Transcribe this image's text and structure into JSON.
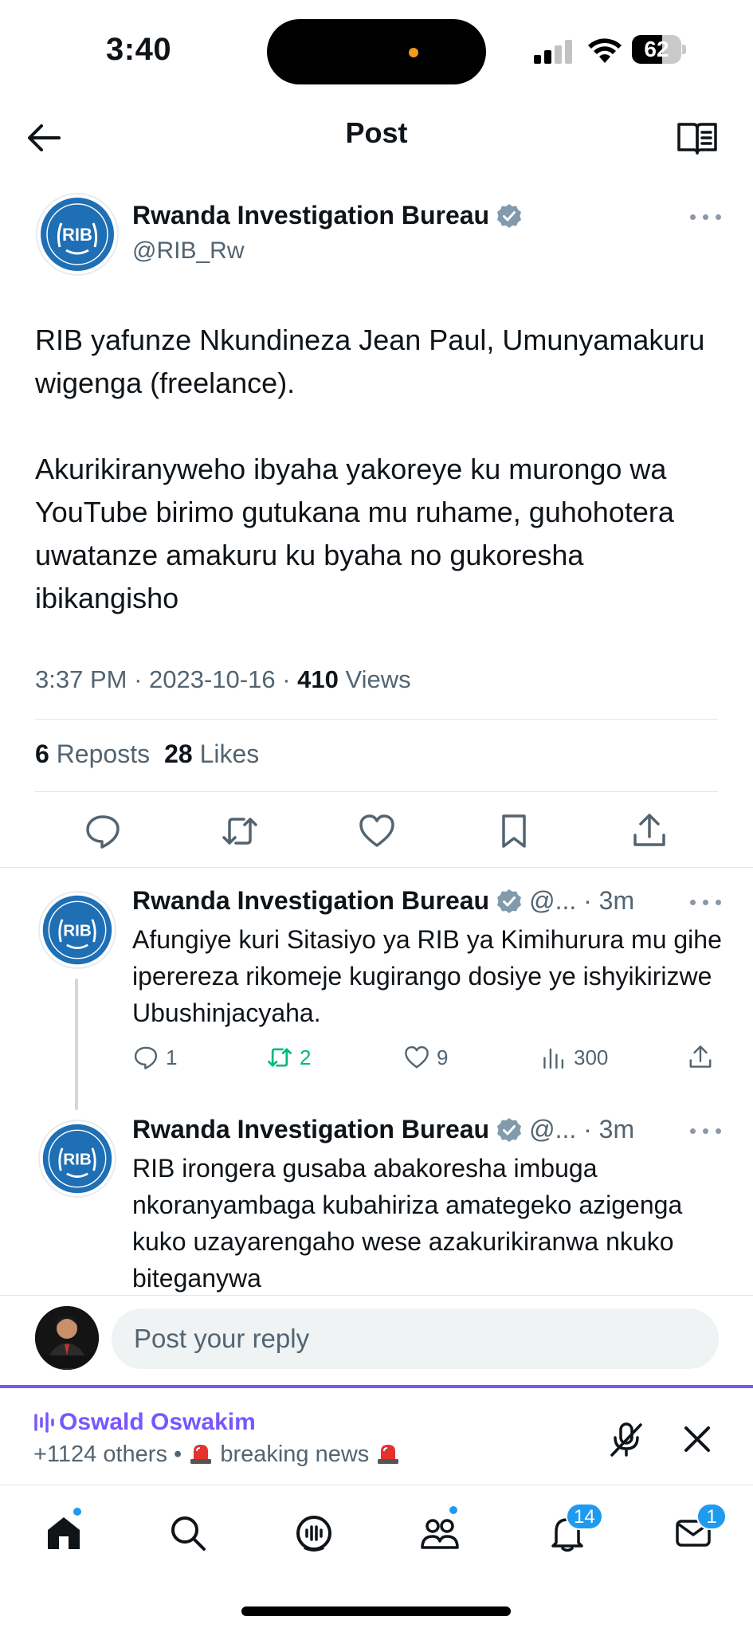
{
  "status_bar": {
    "time": "3:40",
    "battery": "62",
    "battery_level": 0.62
  },
  "header": {
    "title": "Post",
    "back_icon": "arrow-left-icon",
    "reader_icon": "book-open-icon"
  },
  "post": {
    "author_name": "Rwanda Investigation Bureau",
    "handle": "@RIB_Rw",
    "avatar_text": "RIB",
    "paragraphs": [
      "RIB yafunze Nkundineza Jean Paul, Umunyamakuru wigenga (freelance).",
      "Akurikiranyweho ibyaha yakoreye ku murongo wa YouTube birimo gutukana mu ruhame, guhohotera uwatanze amakuru ku byaha no gukoresha ibikangisho"
    ],
    "time": "3:37 PM",
    "date": "2023-10-16",
    "views_count": "410",
    "views_label": "Views",
    "reposts_count": "6",
    "reposts_label": "Reposts",
    "likes_count": "28",
    "likes_label": "Likes"
  },
  "replies": [
    {
      "author_name": "Rwanda Investigation Bureau",
      "meta": "@... · 3m",
      "text": "Afungiye kuri Sitasiyo ya RIB ya Kimihurura mu gihe iperereza rikomeje kugirango dosiye ye ishyikirizwe Ubushinjacyaha.",
      "reply_count": "1",
      "repost_count": "2",
      "like_count": "9",
      "view_count": "300"
    },
    {
      "author_name": "Rwanda Investigation Bureau",
      "meta": "@... · 3m",
      "text": "RIB irongera gusaba abakoresha imbuga nkoranyambaga kubahiriza amategeko azigenga kuko uzayarengaho wese azakurikiranwa nkuko biteganywa"
    }
  ],
  "composer": {
    "placeholder": "Post your reply"
  },
  "space": {
    "host": "Oswald Oswakim",
    "others": "+1124 others",
    "separator": "•",
    "topic": "breaking news",
    "accent": "#7856ff"
  },
  "tabbar": {
    "notifications_badge": "14",
    "messages_badge": "1",
    "items": [
      "home-icon",
      "search-icon",
      "grok-icon",
      "communities-icon",
      "notifications-icon",
      "messages-icon"
    ]
  },
  "colors": {
    "link": "#1d9bf0",
    "muted": "#536471",
    "repost_green": "#00ba7c"
  }
}
